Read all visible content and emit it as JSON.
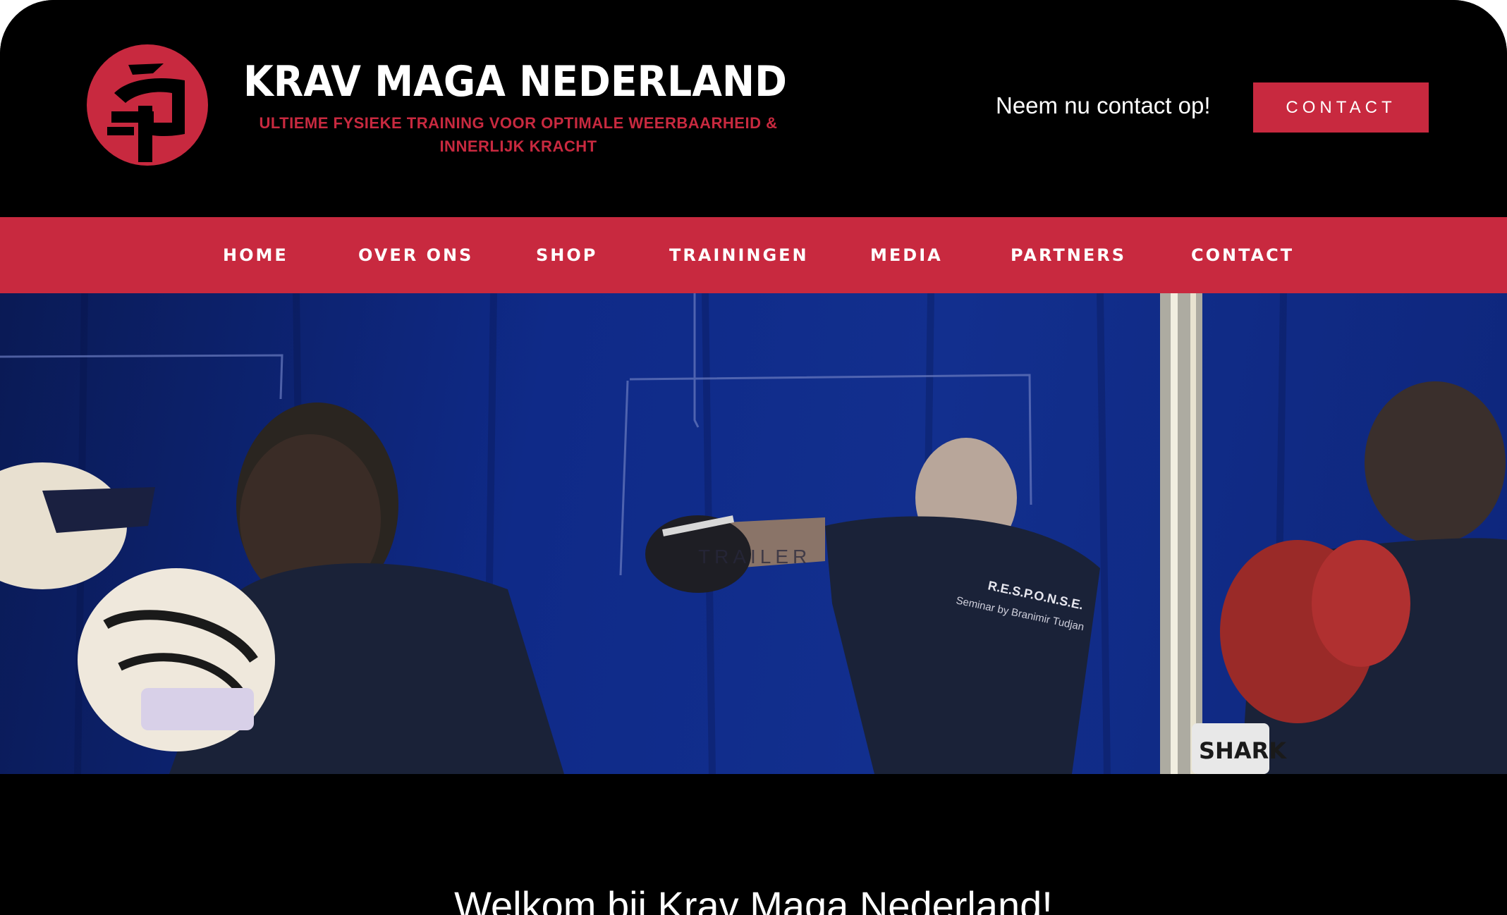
{
  "brand": {
    "title": "KRAV MAGA NEDERLAND",
    "tagline_line1": "ULTIEME FYSIEKE TRAINING VOOR OPTIMALE WEERBAARHEID &",
    "tagline_line2": "INNERLIJK KRACHT",
    "logo_icon": "krav-maga-logo-icon"
  },
  "header": {
    "cta_text": "Neem nu contact op!",
    "contact_button": "CONTACT"
  },
  "nav": {
    "items": [
      {
        "label": "HOME"
      },
      {
        "label": "OVER ONS"
      },
      {
        "label": "SHOP"
      },
      {
        "label": "TRAININGEN"
      },
      {
        "label": "MEDIA"
      },
      {
        "label": "PARTNERS"
      },
      {
        "label": "CONTACT"
      }
    ]
  },
  "hero": {
    "video_label": "TRAILER",
    "shirt_text": "R.E.S.P.O.N.S.E.",
    "shirt_subtext": "Seminar by Branimir Tudjan",
    "glove_text": "SHARK"
  },
  "main": {
    "welcome_title": "Welkom bij Krav Maga Nederland!"
  },
  "colors": {
    "accent": "#c8293f",
    "background": "#000000",
    "text": "#ffffff"
  }
}
